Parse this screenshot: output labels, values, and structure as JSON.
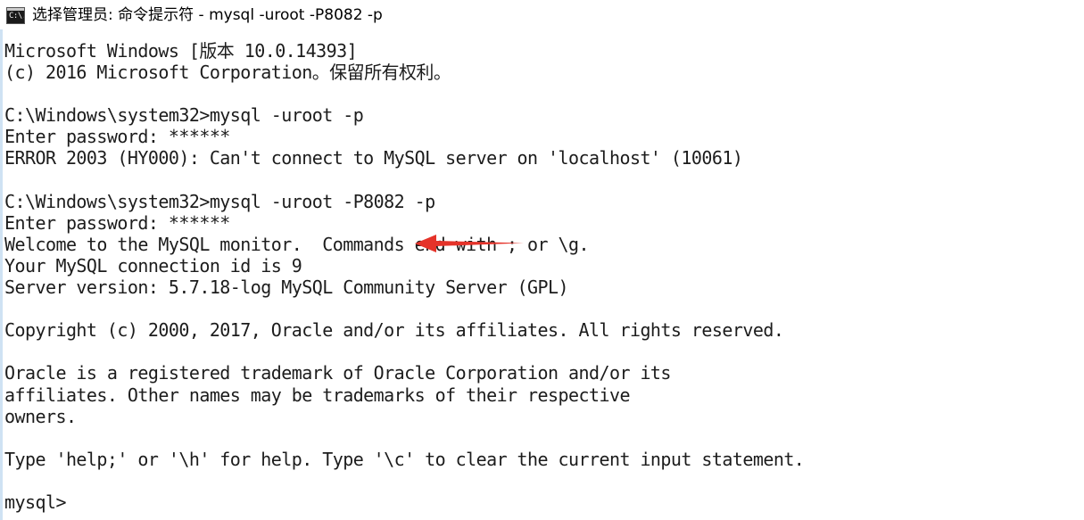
{
  "window": {
    "title": "选择管理员: 命令提示符 - mysql  -uroot -P8082 -p",
    "icon_name": "cmd-console-icon",
    "icon_glyph": "C:\\."
  },
  "colors": {
    "background": "#ffffff",
    "text": "#1c1c1c",
    "left_border": "#cfe2f3",
    "annotation_arrow": "#e5332a"
  },
  "console": {
    "lines": [
      "Microsoft Windows [版本 10.0.14393]",
      "(c) 2016 Microsoft Corporation。保留所有权利。",
      "",
      "C:\\Windows\\system32>mysql -uroot -p",
      "Enter password: ******",
      "ERROR 2003 (HY000): Can't connect to MySQL server on 'localhost' (10061)",
      "",
      "C:\\Windows\\system32>mysql -uroot -P8082 -p",
      "Enter password: ******",
      "Welcome to the MySQL monitor.  Commands end with ; or \\g.",
      "Your MySQL connection id is 9",
      "Server version: 5.7.18-log MySQL Community Server (GPL)",
      "",
      "Copyright (c) 2000, 2017, Oracle and/or its affiliates. All rights reserved.",
      "",
      "Oracle is a registered trademark of Oracle Corporation and/or its",
      "affiliates. Other names may be trademarks of their respective",
      "owners.",
      "",
      "Type 'help;' or '\\h' for help. Type '\\c' to clear the current input statement.",
      "",
      "mysql>"
    ]
  },
  "annotation": {
    "name": "red-arrow-pointing-to-port-flag",
    "points_to": "-P8082",
    "color": "#e5332a",
    "direction": "left"
  }
}
